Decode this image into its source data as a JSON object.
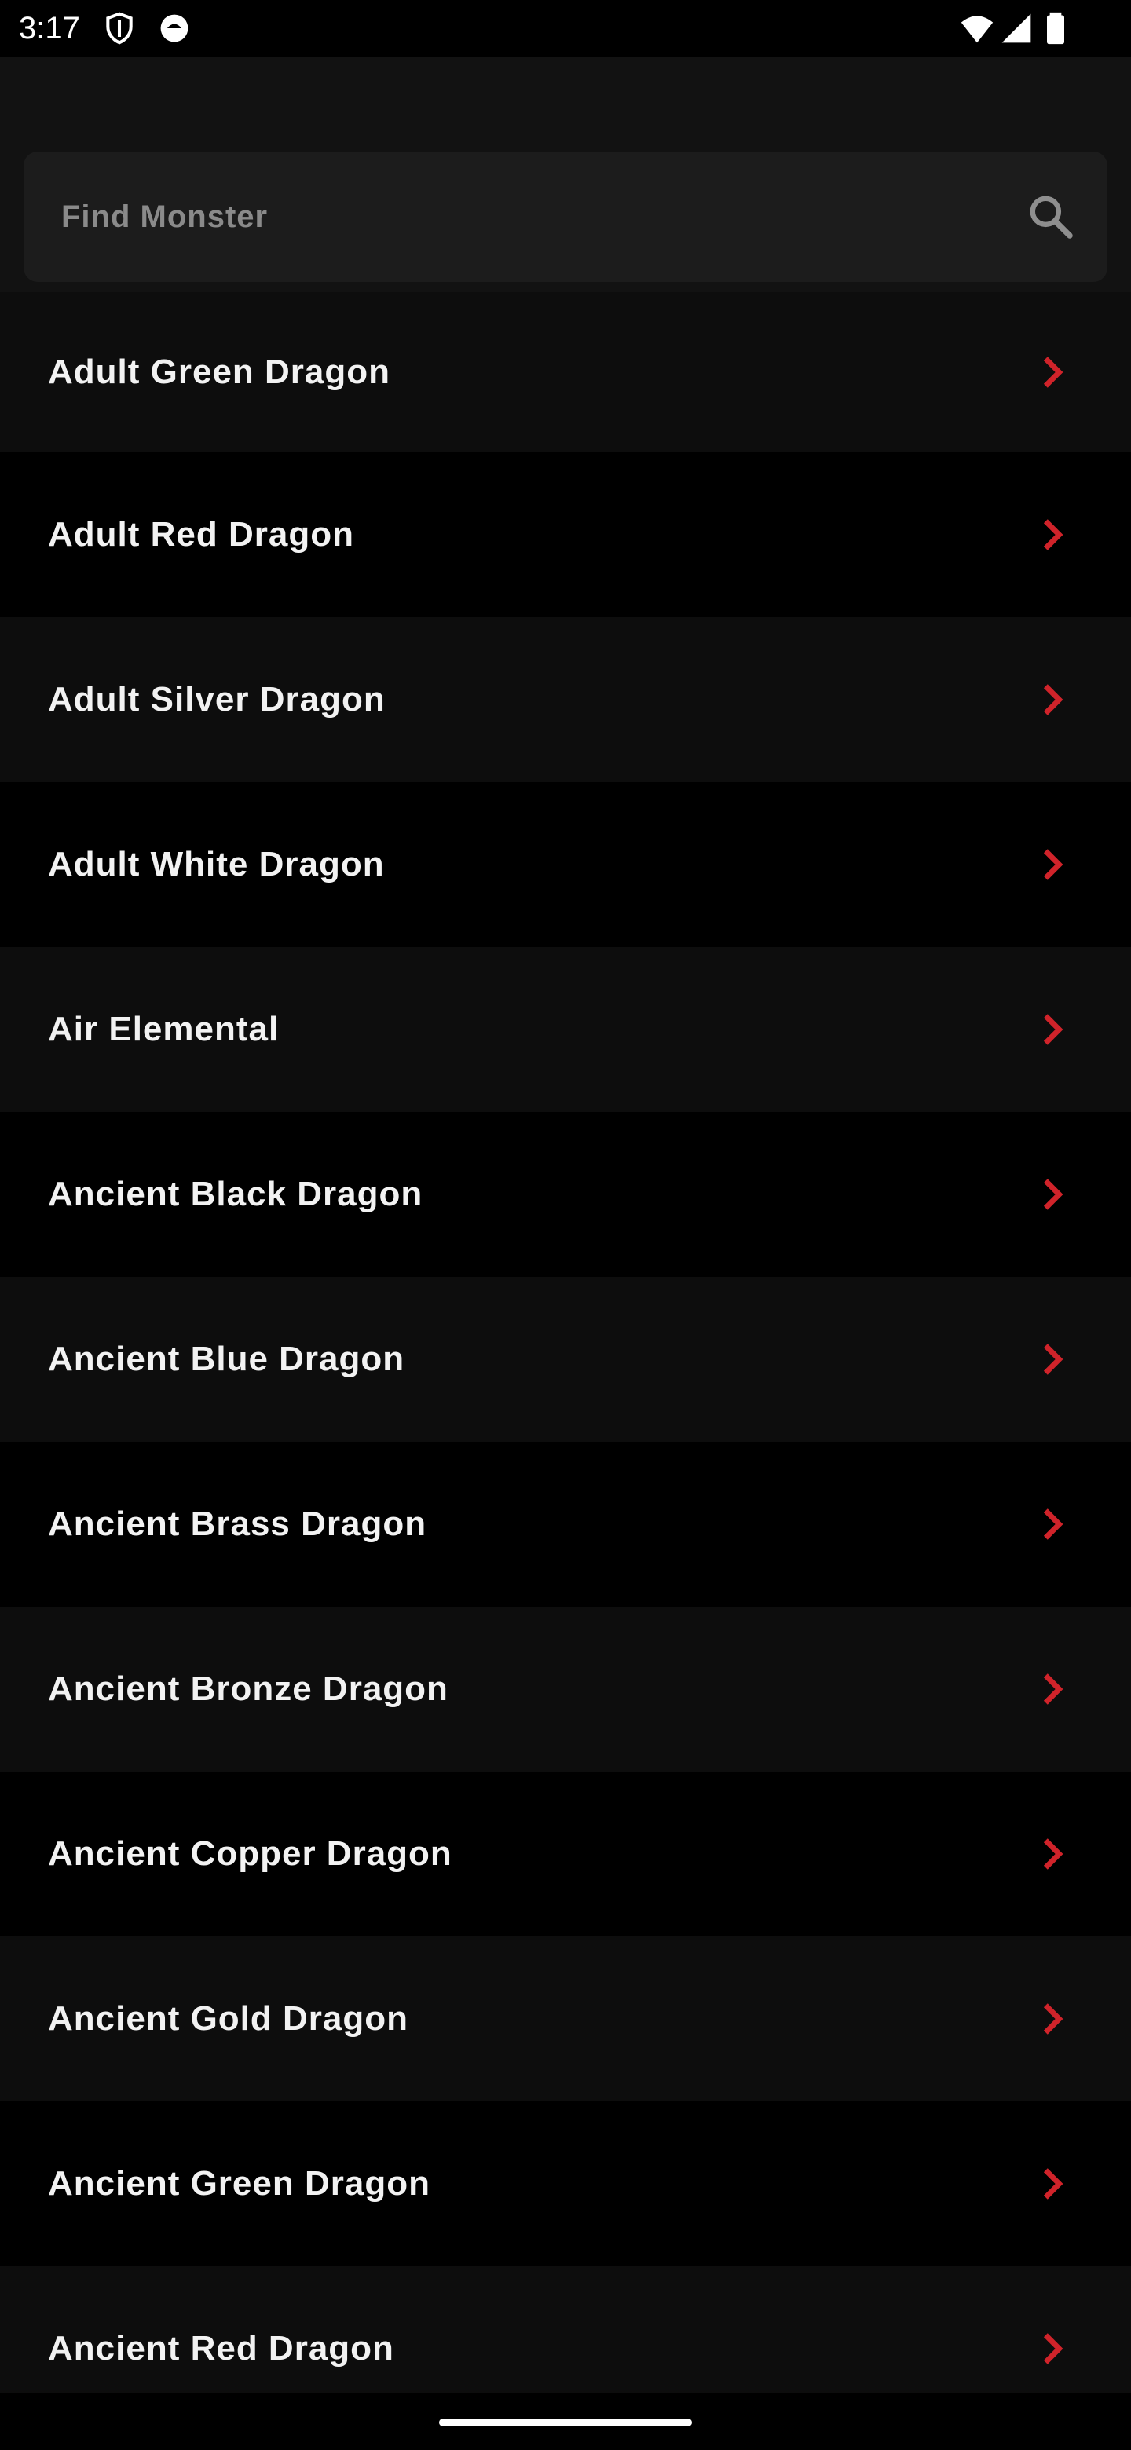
{
  "status_bar": {
    "time": "3:17",
    "left_icons": [
      "shield-icon",
      "face-icon"
    ],
    "right_icons": [
      "wifi-icon",
      "signal-icon",
      "battery-icon"
    ]
  },
  "search": {
    "placeholder": "Find Monster",
    "value": "",
    "icon": "search-icon"
  },
  "monsters": [
    {
      "label": "Adult Green Dragon"
    },
    {
      "label": "Adult Red Dragon"
    },
    {
      "label": "Adult Silver Dragon"
    },
    {
      "label": "Adult White Dragon"
    },
    {
      "label": "Air Elemental"
    },
    {
      "label": "Ancient Black Dragon"
    },
    {
      "label": "Ancient Blue Dragon"
    },
    {
      "label": "Ancient Brass Dragon"
    },
    {
      "label": "Ancient Bronze Dragon"
    },
    {
      "label": "Ancient Copper Dragon"
    },
    {
      "label": "Ancient Gold Dragon"
    },
    {
      "label": "Ancient Green Dragon"
    },
    {
      "label": "Ancient Red Dragon"
    }
  ],
  "colors": {
    "background": "#000000",
    "row_alt": "#0d0d0d",
    "search_box": "#1c1c1c",
    "accent": "#d0232a",
    "text": "#f2f2f2",
    "placeholder": "#8a8a8a"
  }
}
